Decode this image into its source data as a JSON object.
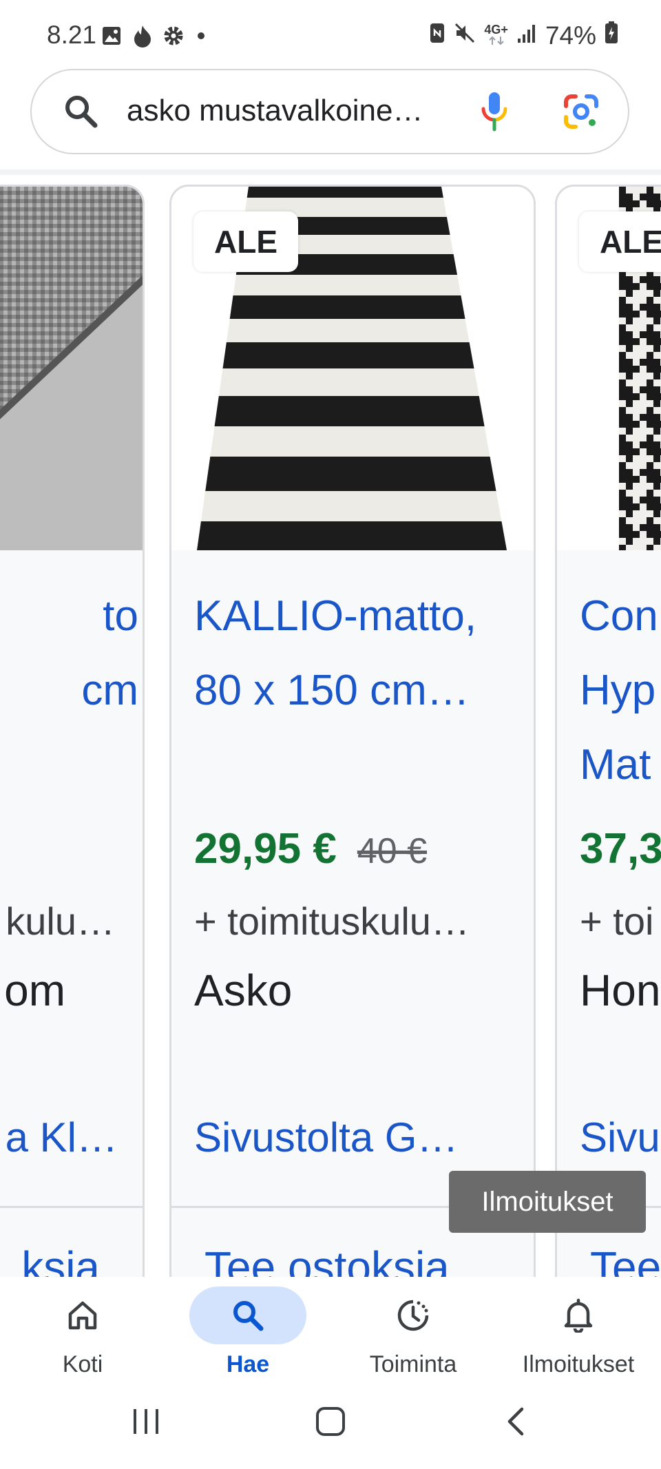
{
  "status_bar": {
    "time": "8.21",
    "network": "4G+",
    "battery": "74%",
    "icons_left": [
      "gallery-icon",
      "fire-icon",
      "gear-icon",
      "dot-icon"
    ],
    "icons_right": [
      "nfc-icon",
      "mute-icon",
      "network-icon",
      "signal-icon",
      "battery-icon"
    ]
  },
  "search": {
    "query": "asko mustavalkoine…",
    "icons": [
      "search-icon",
      "microphone-icon",
      "google-lens-icon"
    ]
  },
  "products": [
    {
      "title": "to\n cm",
      "shipping": "kulu…",
      "seller": "om",
      "source": "a Kl…",
      "shop": "ksia"
    },
    {
      "badge": "ALE",
      "title": "KALLIO-matto, 80 x 150 cm…",
      "price": "29,95 €",
      "old_price": "40 €",
      "shipping": "+ toimituskulu…",
      "seller": "Asko",
      "source": "Sivustolta G…",
      "shop": "Tee ostoksia"
    },
    {
      "badge": "ALE",
      "title": "Con Hyp Mat",
      "price": "37,3",
      "shipping": "+ toi",
      "seller": "Hon",
      "source": "Sivu",
      "shop": "Tee"
    }
  ],
  "toast": "Ilmoitukset",
  "bottom_nav": [
    {
      "label": "Koti",
      "icon": "home-icon",
      "active": false
    },
    {
      "label": "Hae",
      "icon": "search-icon",
      "active": true
    },
    {
      "label": "Toiminta",
      "icon": "activity-icon",
      "active": false
    },
    {
      "label": "Ilmoitukset",
      "icon": "bell-icon",
      "active": false
    }
  ],
  "system_nav": [
    "recent-apps-icon",
    "home-button-icon",
    "back-icon"
  ],
  "colors": {
    "link": "#1a56c8",
    "price": "#137333",
    "active_nav": "#0b57d0",
    "active_pill": "#d3e3fd"
  }
}
